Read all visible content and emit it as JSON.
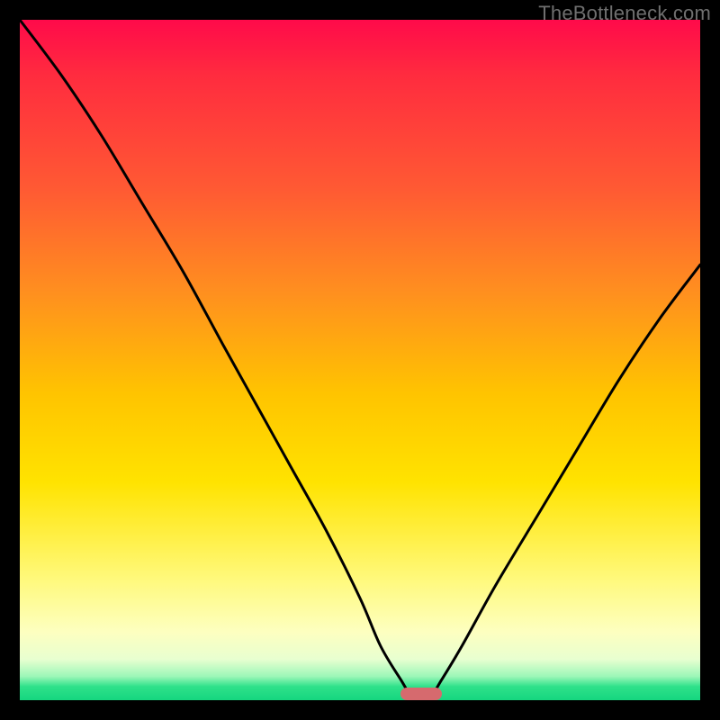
{
  "watermark": "TheBottleneck.com",
  "colors": {
    "frame": "#000000",
    "gradient_top": "#ff0a4a",
    "gradient_bottom": "#15d67f",
    "curve": "#000000",
    "marker": "#d66a6e",
    "watermark": "#6f6f6f"
  },
  "chart_data": {
    "type": "line",
    "title": "",
    "xlabel": "",
    "ylabel": "",
    "xlim": [
      0,
      100
    ],
    "ylim": [
      0,
      100
    ],
    "grid": false,
    "legend": false,
    "series": [
      {
        "name": "bottleneck-curve",
        "x": [
          0,
          6,
          12,
          18,
          24,
          30,
          35,
          40,
          45,
          50,
          53,
          56,
          58,
          60,
          62,
          65,
          70,
          76,
          82,
          88,
          94,
          100
        ],
        "values": [
          100,
          92,
          83,
          73,
          63,
          52,
          43,
          34,
          25,
          15,
          8,
          3,
          0,
          0,
          3,
          8,
          17,
          27,
          37,
          47,
          56,
          64
        ]
      }
    ],
    "marker": {
      "x_start": 56,
      "x_end": 62,
      "y": 0
    },
    "annotations": []
  }
}
